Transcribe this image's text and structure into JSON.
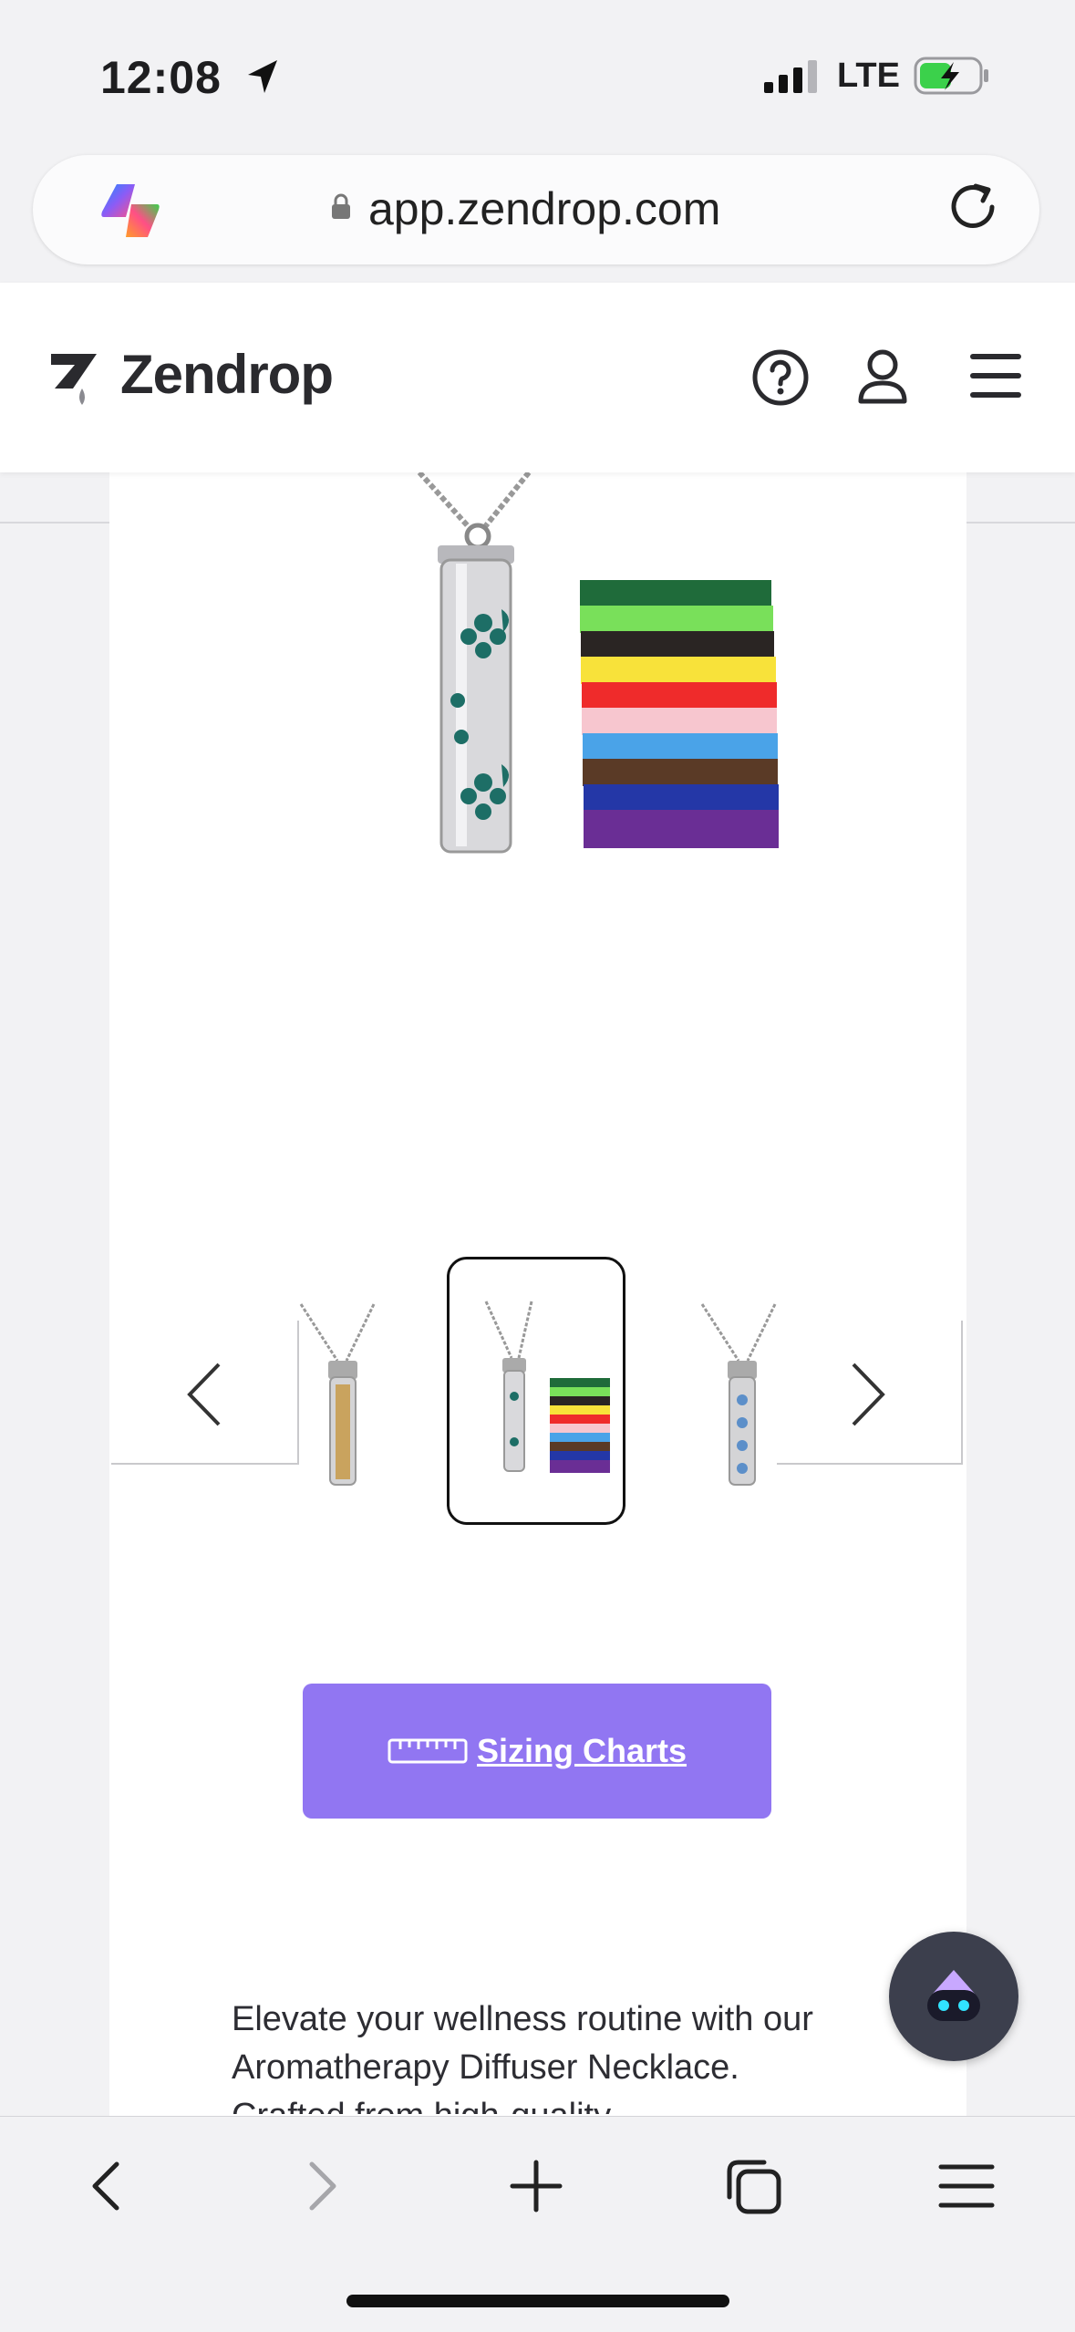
{
  "status_bar": {
    "time": "12:08",
    "network": "LTE",
    "battery_charging": true
  },
  "browser": {
    "url": "app.zendrop.com"
  },
  "site_header": {
    "brand": "Zendrop"
  },
  "product": {
    "image_alt": "Aromatherapy diffuser necklace with colored felt pads",
    "felt_pad_colors": [
      "#1f6b3a",
      "#79e05a",
      "#2a2523",
      "#f8e23a",
      "#ef2b2b",
      "#f7c6cf",
      "#4aa3e8",
      "#5a3a26",
      "#2437a7",
      "#6a2e95"
    ]
  },
  "carousel": {
    "thumbnails": [
      {
        "name": "thumb-gold-pendant",
        "selected": false
      },
      {
        "name": "thumb-teal-pendant-with-pads",
        "selected": true
      },
      {
        "name": "thumb-blue-pendant",
        "selected": false
      }
    ]
  },
  "sizing": {
    "label": "Sizing Charts"
  },
  "description": {
    "text": "Elevate your wellness routine with our Aromatherapy Diffuser Necklace. Crafted from high-quality"
  },
  "colors": {
    "accent": "#9176f2",
    "chat_bg": "#3c3f4d"
  }
}
